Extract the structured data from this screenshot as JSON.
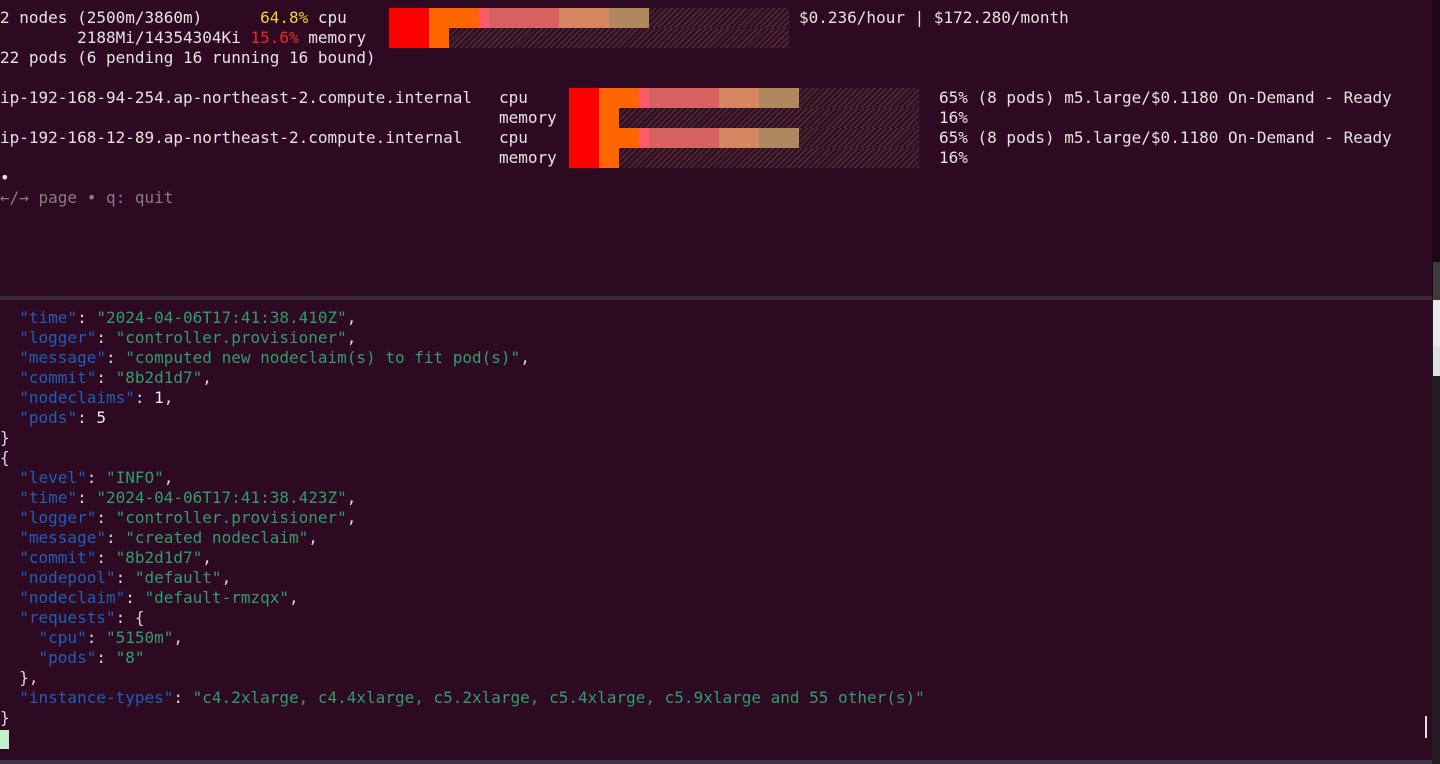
{
  "summary": {
    "nodes_text": "2 nodes (2500m/3860m)",
    "cpu_percent": "64.8%",
    "cpu_label": "cpu",
    "mem_text": "2188Mi/14354304Ki",
    "mem_percent": "15.6%",
    "mem_label": "memory",
    "cost": "$0.236/hour | $172.280/month",
    "pods_text": "22 pods (6 pending 16 running 16 bound)"
  },
  "nodes": [
    {
      "name": "ip-192-168-94-254.ap-northeast-2.compute.internal",
      "cpu_label": "cpu",
      "mem_label": "memory",
      "info": "65% (8 pods) m5.large/$0.1180 On-Demand - Ready",
      "mem_pct": "16%",
      "cpu_fill": 0.65,
      "mem_fill": 0.16
    },
    {
      "name": "ip-192-168-12-89.ap-northeast-2.compute.internal",
      "cpu_label": "cpu",
      "mem_label": "memory",
      "info": "65% (8 pods) m5.large/$0.1180 On-Demand - Ready",
      "mem_pct": "16%",
      "cpu_fill": 0.65,
      "mem_fill": 0.16
    }
  ],
  "help": {
    "bullet": "•",
    "text": "←/→ page • q: quit"
  },
  "log1": {
    "time": "\"2024-04-06T17:41:38.410Z\"",
    "logger": "\"controller.provisioner\"",
    "message": "\"computed new nodeclaim(s) to fit pod(s)\"",
    "commit": "\"8b2d1d7\"",
    "nodeclaims": "1",
    "pods": "5"
  },
  "log2": {
    "level": "\"INFO\"",
    "time": "\"2024-04-06T17:41:38.423Z\"",
    "logger": "\"controller.provisioner\"",
    "message": "\"created nodeclaim\"",
    "commit": "\"8b2d1d7\"",
    "nodepool": "\"default\"",
    "nodeclaim": "\"default-rmzqx\"",
    "requests_cpu": "\"5150m\"",
    "requests_pods": "\"8\"",
    "instance_types": "\"c4.2xlarge, c4.4xlarge, c5.2xlarge, c5.4xlarge, c5.9xlarge and 55 other(s)\""
  },
  "keys": {
    "level": "\"level\"",
    "time": "\"time\"",
    "logger": "\"logger\"",
    "message": "\"message\"",
    "commit": "\"commit\"",
    "nodeclaims": "\"nodeclaims\"",
    "pods": "\"pods\"",
    "nodepool": "\"nodepool\"",
    "nodeclaim": "\"nodeclaim\"",
    "requests": "\"requests\"",
    "cpu": "\"cpu\"",
    "instance_types": "\"instance-types\""
  },
  "colors": {
    "background": "#2d0922",
    "json_key": "#1f5fb8",
    "json_string": "#2f9e6c",
    "cpu_highlight": "#f2d42c",
    "mem_highlight": "#f0282a",
    "bar_red": "#ff0000",
    "bar_orange": "#ff6600",
    "bar_pink": "#ff5a6a",
    "bar_rose": "#d76060",
    "bar_salmon": "#d68660",
    "bar_tan": "#b08860"
  }
}
